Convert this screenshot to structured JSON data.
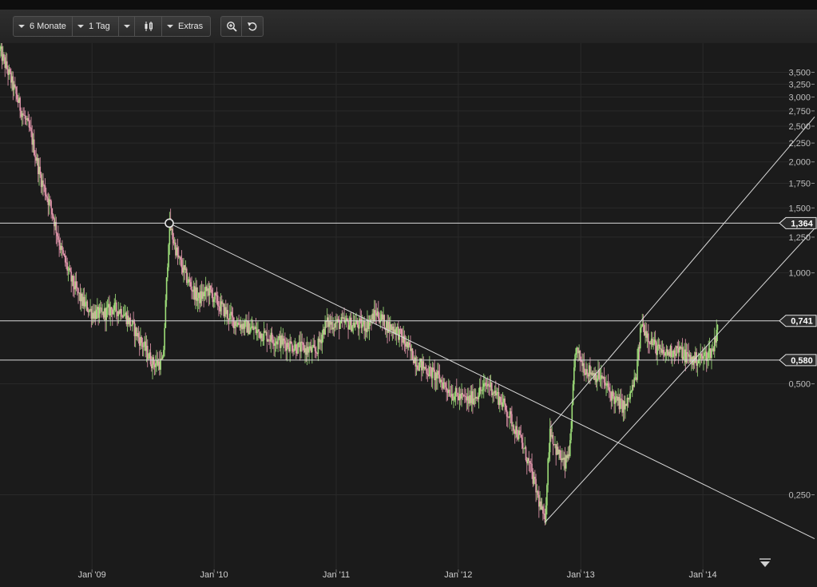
{
  "toolbar": {
    "period_label": "6 Monate",
    "interval_label": "1 Tag",
    "extras_label": "Extras",
    "chart_type_icon": "candlestick-icon",
    "zoom_icon": "zoom-in-icon",
    "undo_icon": "undo-icon"
  },
  "colors": {
    "background": "#1b1b1b",
    "up_candle": "#9fe07a",
    "down_candle": "#e79ab0",
    "line": "#d9d9d9",
    "grid": "#2a2a2a"
  },
  "chart_data": {
    "type": "candlestick",
    "x_tick_labels": [
      "Jan '09",
      "Jan '10",
      "Jan '11",
      "Jan '12",
      "Jan '13",
      "Jan '14"
    ],
    "x_ticks": [
      "2009-01",
      "2010-01",
      "2011-01",
      "2012-01",
      "2013-01",
      "2014-01"
    ],
    "x_range": [
      "2008-04",
      "2014-12"
    ],
    "y_scale": "log",
    "y_ticks": [
      0.25,
      0.5,
      1.0,
      1.25,
      1.5,
      1.75,
      2.0,
      2.25,
      2.5,
      2.75,
      3.0,
      3.25,
      3.5
    ],
    "y_tick_labels": [
      "0,250",
      "0,500",
      "1,000",
      "1,250",
      "1,500",
      "1,750",
      "2,000",
      "2,250",
      "2,500",
      "2,750",
      "3,000",
      "3,250",
      "3,500"
    ],
    "ylim": [
      0.16,
      4.2
    ],
    "grid": true,
    "price_path": [
      [
        "2008-04-01",
        4.0
      ],
      [
        "2008-05-01",
        3.4
      ],
      [
        "2008-06-01",
        2.8
      ],
      [
        "2008-07-01",
        2.4
      ],
      [
        "2008-08-01",
        1.8
      ],
      [
        "2008-09-01",
        1.5
      ],
      [
        "2008-10-01",
        1.15
      ],
      [
        "2008-11-01",
        0.95
      ],
      [
        "2008-12-01",
        0.84
      ],
      [
        "2009-01-01",
        0.78
      ],
      [
        "2009-02-01",
        0.77
      ],
      [
        "2009-03-01",
        0.8
      ],
      [
        "2009-04-01",
        0.79
      ],
      [
        "2009-05-01",
        0.72
      ],
      [
        "2009-06-01",
        0.64
      ],
      [
        "2009-07-01",
        0.57
      ],
      [
        "2009-08-01",
        0.57
      ],
      [
        "2009-08-20",
        1.36
      ],
      [
        "2009-09-15",
        1.1
      ],
      [
        "2009-10-15",
        0.95
      ],
      [
        "2009-11-15",
        0.85
      ],
      [
        "2009-12-15",
        0.9
      ],
      [
        "2010-01-15",
        0.82
      ],
      [
        "2010-03-01",
        0.74
      ],
      [
        "2010-05-01",
        0.7
      ],
      [
        "2010-07-01",
        0.66
      ],
      [
        "2010-09-01",
        0.63
      ],
      [
        "2010-11-01",
        0.61
      ],
      [
        "2010-12-01",
        0.73
      ],
      [
        "2011-02-01",
        0.73
      ],
      [
        "2011-04-01",
        0.72
      ],
      [
        "2011-05-01",
        0.78
      ],
      [
        "2011-06-01",
        0.72
      ],
      [
        "2011-07-01",
        0.7
      ],
      [
        "2011-09-01",
        0.57
      ],
      [
        "2011-11-01",
        0.52
      ],
      [
        "2011-12-15",
        0.47
      ],
      [
        "2012-02-01",
        0.45
      ],
      [
        "2012-04-01",
        0.5
      ],
      [
        "2012-05-15",
        0.44
      ],
      [
        "2012-07-01",
        0.36
      ],
      [
        "2012-08-01",
        0.3
      ],
      [
        "2012-09-15",
        0.21
      ],
      [
        "2012-10-01",
        0.38
      ],
      [
        "2012-10-20",
        0.33
      ],
      [
        "2012-11-15",
        0.3
      ],
      [
        "2012-12-01",
        0.34
      ],
      [
        "2012-12-15",
        0.62
      ],
      [
        "2013-01-15",
        0.55
      ],
      [
        "2013-03-01",
        0.52
      ],
      [
        "2013-04-15",
        0.45
      ],
      [
        "2013-05-15",
        0.43
      ],
      [
        "2013-06-15",
        0.52
      ],
      [
        "2013-07-01",
        0.73
      ],
      [
        "2013-08-01",
        0.65
      ],
      [
        "2013-09-01",
        0.6
      ],
      [
        "2013-10-15",
        0.62
      ],
      [
        "2013-12-01",
        0.58
      ],
      [
        "2014-01-01",
        0.59
      ],
      [
        "2014-02-01",
        0.62
      ],
      [
        "2014-02-15",
        0.74
      ]
    ],
    "horizontal_lines": [
      {
        "value": 1.364,
        "label": "1,364"
      },
      {
        "value": 0.741,
        "label": "0,741"
      },
      {
        "value": 0.58,
        "label": "0,580"
      }
    ],
    "trend_lines": [
      {
        "from": [
          "2009-08-20",
          1.364
        ],
        "to": [
          "2014-12-01",
          0.19
        ]
      },
      {
        "from": [
          "2012-09-15",
          0.21
        ],
        "to": [
          "2014-12-01",
          1.32
        ]
      },
      {
        "from": [
          "2012-10-01",
          0.38
        ],
        "to": [
          "2014-12-01",
          2.65
        ]
      }
    ],
    "anchor_point": [
      "2009-08-20",
      1.364
    ]
  }
}
